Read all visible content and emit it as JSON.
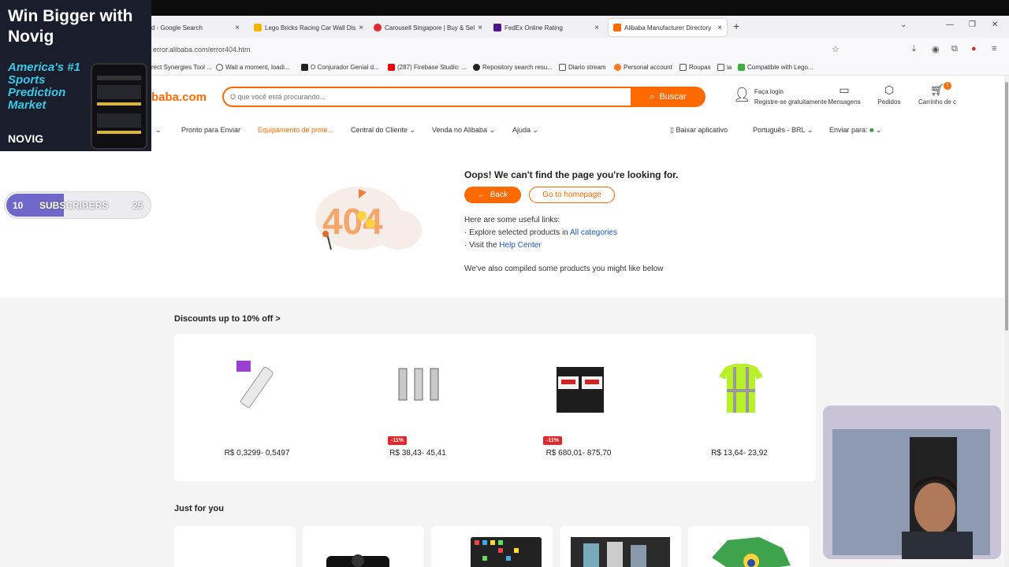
{
  "tabs": [
    {
      "title": "d - Google Search",
      "color": "#4285f4"
    },
    {
      "title": "Lego Bricks Racing Car Wall Dis",
      "color": "#f7b500"
    },
    {
      "title": "Carousell Singapore | Buy & Sel",
      "color": "#e5262b"
    },
    {
      "title": "FedEx Online Rating",
      "color": "#4d148c"
    },
    {
      "title": "Alibaba Manufacturer Directory",
      "color": "#ff6a00"
    }
  ],
  "url": "error.alibaba.com/error404.htm",
  "bookmarks": [
    "rect Synergies Tool ...",
    "Wait a moment, loadi...",
    "O Conjurador Genial d...",
    "(287) Firebase Studio: ...",
    "Repository search resu...",
    "Diario stream",
    "Personal account",
    "Roupas",
    "ia",
    "Compatible with Lego..."
  ],
  "header": {
    "logo": "baba.com",
    "search_placeholder": "O que você está procurando...",
    "search_button": "Buscar",
    "login": "Faça login",
    "register": "Registre-se gratuitamente",
    "messages": "Mensagens",
    "orders": "Pedidos",
    "cart": "Carrinho de c",
    "cart_count": "1"
  },
  "nav": {
    "items": [
      "Pronto para Enviar",
      "Equipamento de prote...",
      "Central do Cliente",
      "Venda no Alibaba",
      "Ajuda"
    ],
    "app": "Baixar aplicativo",
    "language": "Português - BRL",
    "ship_to": "Enviar para:"
  },
  "error": {
    "title": "Oops! We can't find the page you're looking for.",
    "back": "Back",
    "home": "Go to homepage",
    "links_intro": "Here are some useful links:",
    "line1_prefix": "· Explore selected products in",
    "line1_link": "All categories",
    "line2_prefix": "· Visit the",
    "line2_link": "Help Center",
    "compiled": "We've also compiled some products you might like below",
    "graphic_text": "404"
  },
  "discounts": {
    "title": "Discounts up to 10% off >",
    "products": [
      {
        "price": "R$ 0,3299- 0,5497",
        "discount": ""
      },
      {
        "price": "R$ 38,43- 45,41",
        "discount": "-11%"
      },
      {
        "price": "R$ 680,01- 875,70",
        "discount": "-11%"
      },
      {
        "price": "R$ 13,64- 23,92",
        "discount": ""
      }
    ]
  },
  "just_for_you": "Just for you",
  "overlay_ad": {
    "headline": "Win Bigger with Novig",
    "sub": "America's #1 Sports Prediction Market",
    "brand": "NOVIG"
  },
  "subscribers": {
    "current": "10",
    "label": "SUBSCRIBERS",
    "goal": "25",
    "progress": 0.4
  }
}
